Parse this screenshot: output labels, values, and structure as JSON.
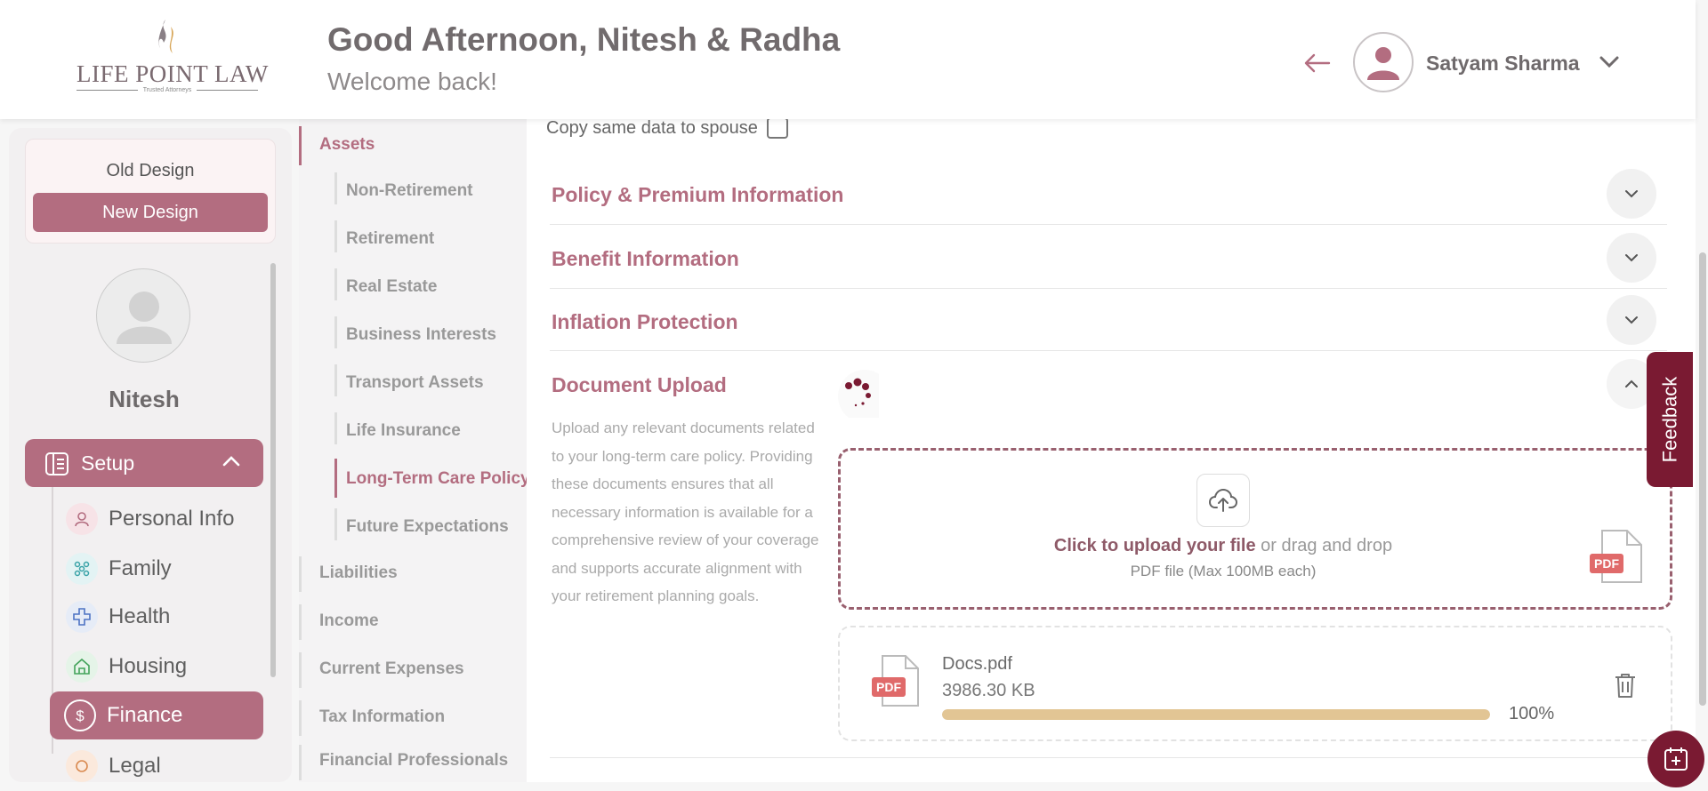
{
  "header": {
    "logo_text": "LIFE POINT LAW",
    "logo_tagline": "Trusted Attorneys",
    "greeting": "Good Afternoon, Nitesh & Radha",
    "welcome": "Welcome back!",
    "user_name": "Satyam Sharma"
  },
  "sidebar": {
    "old_design": "Old Design",
    "new_design": "New Design",
    "profile_name": "Nitesh",
    "setup_label": "Setup",
    "items": [
      {
        "label": "Personal Info",
        "icon": "person-icon"
      },
      {
        "label": "Family",
        "icon": "family-icon"
      },
      {
        "label": "Health",
        "icon": "health-cross-icon"
      },
      {
        "label": "Housing",
        "icon": "house-icon"
      },
      {
        "label": "Finance",
        "icon": "dollar-icon"
      },
      {
        "label": "Legal",
        "icon": "legal-icon"
      }
    ]
  },
  "subnav": {
    "assets": "Assets",
    "asset_items": [
      "Non-Retirement",
      "Retirement",
      "Real Estate",
      "Business Interests",
      "Transport Assets",
      "Life Insurance",
      "Long-Term Care Policy",
      "Future Expectations"
    ],
    "sections": [
      "Liabilities",
      "Income",
      "Current Expenses",
      "Tax Information",
      "Financial Professionals"
    ]
  },
  "main": {
    "copy_label": "Copy same data to spouse",
    "accordions": [
      "Policy & Premium Information",
      "Benefit Information",
      "Inflation Protection",
      "Document Upload"
    ],
    "upload_description": "Upload any relevant documents related to your long-term care policy. Providing these documents ensures that all necessary information is available for a comprehensive review of your coverage and supports accurate alignment with your retirement planning goals.",
    "upload_click": "Click to upload your file",
    "upload_drag": " or drag and drop",
    "upload_hint": "PDF file (Max 100MB each)",
    "pdf_badge": "PDF",
    "file": {
      "name": "Docs.pdf",
      "size": "3986.30 KB",
      "progress": 100,
      "progress_label": "100%"
    }
  },
  "feedback_label": "Feedback",
  "colors": {
    "accent": "#b36d80",
    "dark_accent": "#7a1a32",
    "progress": "#e2c594"
  }
}
